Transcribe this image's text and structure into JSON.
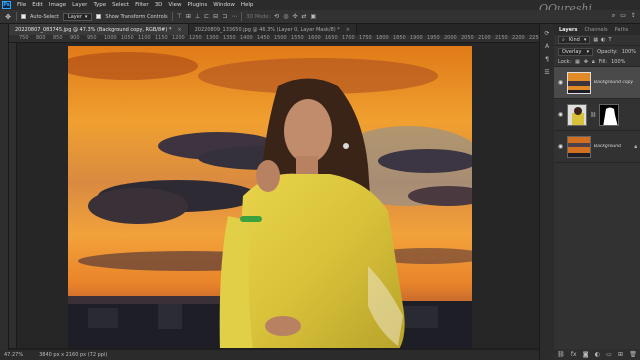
{
  "menu": [
    "File",
    "Edit",
    "Image",
    "Layer",
    "Type",
    "Select",
    "Filter",
    "3D",
    "View",
    "Plugins",
    "Window",
    "Help"
  ],
  "options": {
    "auto_select_label": "Auto-Select",
    "auto_select_value": "Layer",
    "show_transform_label": "Show Transform Controls",
    "mode_label": "3D Mode:"
  },
  "watermark": "QQureshi",
  "tabs": [
    {
      "label": "20220807_083745.jpg @ 47.3% (Background copy, RGB/8#) *"
    },
    {
      "label": "20220809_133650.jpg @ 46.3% (Layer 0, Layer Mask/8) *"
    }
  ],
  "ruler_top": [
    "750",
    "800",
    "850",
    "900",
    "950",
    "1000",
    "1050",
    "1100",
    "1150",
    "1200",
    "1250",
    "1300",
    "1350",
    "1400",
    "1450",
    "1500",
    "1550",
    "1600",
    "1650",
    "1700",
    "1750",
    "1800",
    "1850",
    "1900",
    "1950",
    "2000",
    "2050",
    "2100",
    "2150",
    "2200",
    "2250"
  ],
  "status": {
    "zoom": "47.27%",
    "doc": "3840 px x 2160 px (72 ppi)"
  },
  "layers_panel": {
    "tabs": [
      "Layers",
      "Channels",
      "Paths"
    ],
    "filter_label": "Kind",
    "blend_mode": "Overlay",
    "opacity_label": "Opacity:",
    "opacity_value": "100%",
    "lock_label": "Lock:",
    "fill_label": "Fill:",
    "fill_value": "100%",
    "layers": [
      {
        "name": "Background copy",
        "selected": true
      },
      {
        "name": "",
        "selected": false
      },
      {
        "name": "Background",
        "selected": false
      }
    ]
  },
  "colors": {
    "accent": "#31a8ff",
    "panel": "#323232",
    "canvas_bg": "#262626"
  }
}
